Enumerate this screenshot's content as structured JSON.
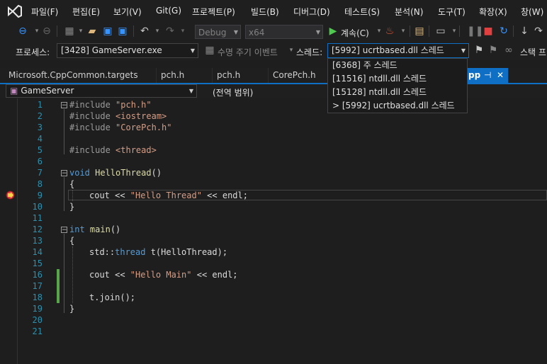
{
  "menu": {
    "items": [
      "파일(F)",
      "편집(E)",
      "보기(V)",
      "Git(G)",
      "프로젝트(P)",
      "빌드(B)",
      "디버그(D)",
      "테스트(S)",
      "분석(N)",
      "도구(T)",
      "확장(X)",
      "창(W)"
    ]
  },
  "toolbar": {
    "config": "Debug",
    "platform": "x64",
    "continue_label": "계속(C)"
  },
  "process_bar": {
    "process_label": "프로세스:",
    "process_value": "[3428] GameServer.exe",
    "lifecycle_label": "수명 주기 이벤트",
    "thread_label": "스레드:",
    "thread_value": "[5992] ucrtbased.dll 스레드",
    "stackframe_label": "스택 프"
  },
  "thread_dropdown": {
    "options": [
      "[6368] 주 스레드",
      "[11516] ntdll.dll 스레드",
      "[15128] ntdll.dll 스레드",
      "> [5992] ucrtbased.dll 스레드"
    ]
  },
  "tabs": [
    "Microsoft.CppCommon.targets",
    "pch.h",
    "pch.h",
    "CorePch.h",
    "pp"
  ],
  "navbar": {
    "project": "GameServer",
    "scope": "(전역 범위)"
  },
  "code": {
    "line_numbers": [
      "1",
      "2",
      "3",
      "4",
      "5",
      "6",
      "7",
      "8",
      "9",
      "10",
      "11",
      "12",
      "13",
      "14",
      "15",
      "16",
      "17",
      "18",
      "19",
      "20",
      "21"
    ],
    "inc_pch": "\"pch.h\"",
    "inc_iostream": "<iostream>",
    "inc_corepch": "\"CorePch.h\"",
    "inc_thread": "<thread>",
    "hello_thread_fn": "HelloThread",
    "hello_thread_str": "\"Hello Thread\"",
    "main_fn": "main",
    "hello_main_str": "\"Hello Main\""
  },
  "colors": {
    "accent": "#0e6fc5",
    "keyword": "#569cd6",
    "string": "#d69d85",
    "line_number": "#2b91af",
    "change_bar": "#57a64a"
  }
}
